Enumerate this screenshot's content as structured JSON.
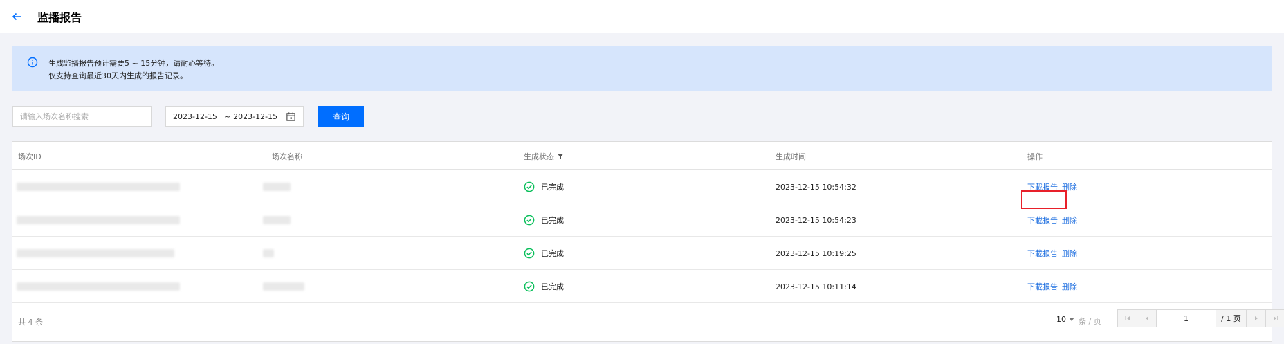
{
  "header": {
    "title": "监播报告"
  },
  "notice": {
    "lines": [
      "生成监播报告预计需要5 ~ 15分钟，请耐心等待。",
      "仅支持查询最近30天内生成的报告记录。"
    ]
  },
  "filters": {
    "search_placeholder": "请输入场次名称搜索",
    "date_start": "2023-12-15",
    "date_sep": "~",
    "date_end": "2023-12-15",
    "query_label": "查询"
  },
  "table": {
    "columns": [
      "场次ID",
      "场次名称",
      "生成状态",
      "生成时间",
      "操作"
    ],
    "rows": [
      {
        "status": "已完成",
        "time": "2023-12-15 10:54:32",
        "download": "下載报告",
        "delete": "删除"
      },
      {
        "status": "已完成",
        "time": "2023-12-15 10:54:23",
        "download": "下載报告",
        "delete": "删除"
      },
      {
        "status": "已完成",
        "time": "2023-12-15 10:19:25",
        "download": "下載报告",
        "delete": "删除"
      },
      {
        "status": "已完成",
        "time": "2023-12-15 10:11:14",
        "download": "下載报告",
        "delete": "删除"
      }
    ]
  },
  "pagination": {
    "total": "共 4 条",
    "page_size": "10",
    "per_page_label": "条 / 页",
    "current_page": "1",
    "page_total": "/ 1 页"
  },
  "colors": {
    "accent": "#006eff",
    "success": "#0abf5b",
    "highlight": "#e8202a",
    "notice_bg": "#d6e5fc"
  }
}
